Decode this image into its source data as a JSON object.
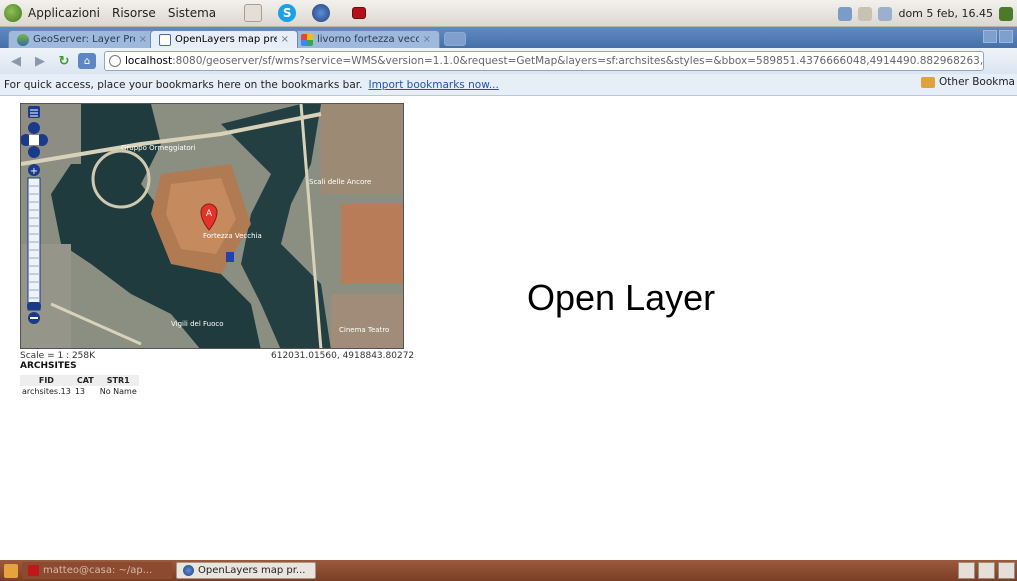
{
  "top_panel": {
    "menus": [
      "Applicazioni",
      "Risorse",
      "Sistema"
    ],
    "clock": "dom 5 feb, 16.45"
  },
  "tabs": [
    {
      "label": "GeoServer: Layer Pre...",
      "close": "×"
    },
    {
      "label": "OpenLayers map pre...",
      "close": "×"
    },
    {
      "label": "livorno fortezza vecc...",
      "close": "×"
    }
  ],
  "toolbar": {
    "url_host": "localhost",
    "url_rest": ":8080/geoserver/sf/wms?service=WMS&version=1.1.0&request=GetMap&layers=sf:archsites&styles=&bbox=589851.4376666048,4914490.882968263,608346.4603"
  },
  "bookmarks_bar": {
    "hint": "For quick access, place your bookmarks here on the bookmarks bar.",
    "import_link": "Import bookmarks now...",
    "other": "Other Bookma"
  },
  "map": {
    "scale": "Scale = 1 : 258K",
    "coords": "612031.01560, 4918843.80272",
    "layer_title": "ARCHSITES",
    "columns": [
      "FID",
      "CAT",
      "STR1"
    ],
    "rows": [
      [
        "archsites.13",
        "13",
        "No Name"
      ]
    ],
    "labels": {
      "gruppo": "Gruppo Ormeggiatori",
      "scali": "Scali delle Ancore",
      "fortezza": "Fortezza Vecchia",
      "vigili": "Vigili del Fuoco",
      "cinema": "Cinema Teatro",
      "marker": "A"
    }
  },
  "caption": "Open Layer",
  "taskbar": {
    "items": [
      "matteo@casa: ~/ap...",
      "OpenLayers map pr..."
    ]
  }
}
